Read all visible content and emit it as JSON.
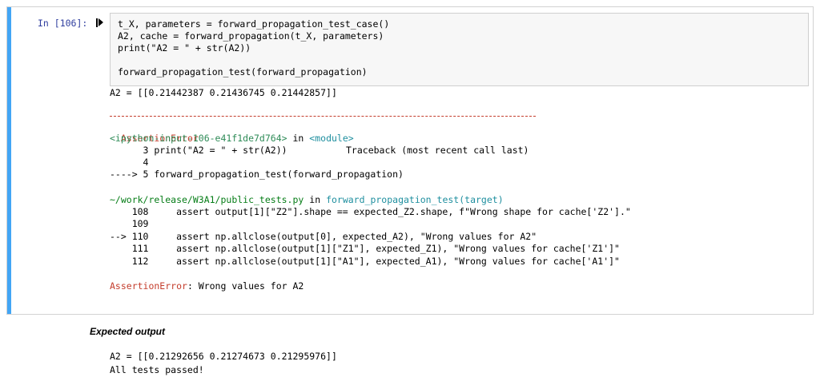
{
  "cell": {
    "prompt": "In [106]:",
    "code_lines": [
      "t_X, parameters = forward_propagation_test_case()",
      "A2, cache = forward_propagation(t_X, parameters)",
      "print(\"A2 = \" + str(A2))",
      "",
      "forward_propagation_test(forward_propagation)"
    ]
  },
  "output": {
    "a2_line": "A2 = [[0.21442387 0.21436745 0.21442857]]",
    "error_name": "AssertionError",
    "traceback_header": "Traceback (most recent call last)",
    "input_ref": "<ipython-input-106-e41f1de7d764>",
    "in_word": "in",
    "module_ref": "<module>",
    "tb1_lines": [
      "      3 print(\"A2 = \" + str(A2))",
      "      4 ",
      "----> 5 forward_propagation_test(forward_propagation)"
    ],
    "file_path": "~/work/release/W3A1/public_tests.py",
    "func_ref": "forward_propagation_test(target)",
    "tb2_lines": [
      "    108     assert output[1][\"Z2\"].shape == expected_Z2.shape, f\"Wrong shape for cache['Z2'].\"",
      "    109 ",
      "--> 110     assert np.allclose(output[0], expected_A2), \"Wrong values for A2\"",
      "    111     assert np.allclose(output[1][\"Z1\"], expected_Z1), \"Wrong values for cache['Z1']\"",
      "    112     assert np.allclose(output[1][\"A1\"], expected_A1), \"Wrong values for cache['A1']\""
    ],
    "final_error_msg": ": Wrong values for A2"
  },
  "expected": {
    "title": "Expected output",
    "a2_line": "A2 = [[0.21292656 0.21274673 0.21295976]]",
    "passed_line": "All tests passed!"
  },
  "colors": {
    "cell_bar": "#42a5f5",
    "prompt": "#303f9f",
    "error": "#c43d2c"
  }
}
